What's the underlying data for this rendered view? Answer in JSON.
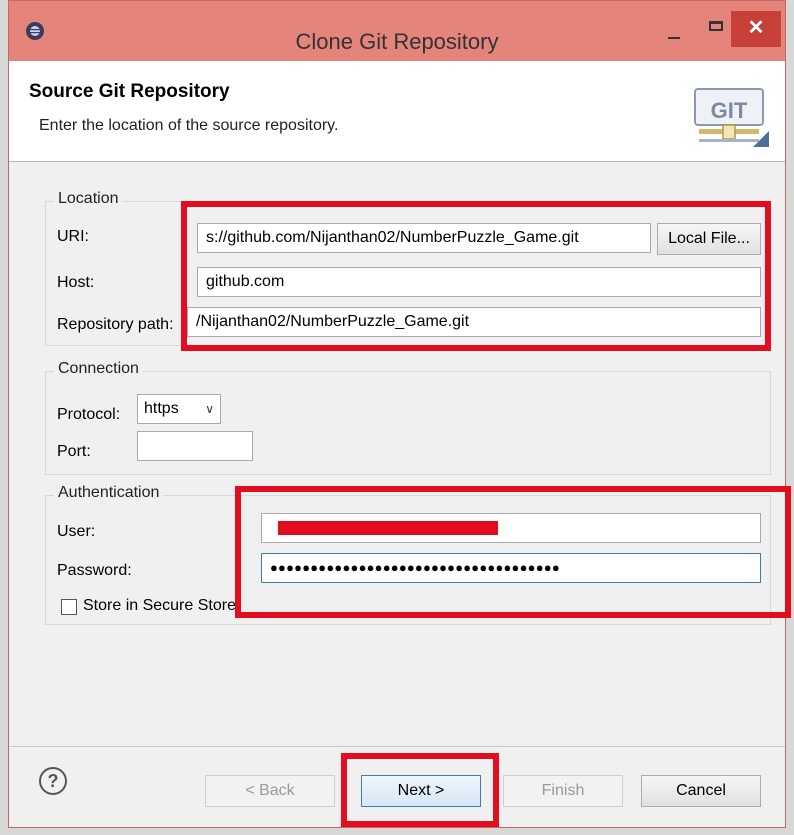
{
  "window": {
    "title": "Clone Git Repository",
    "close_glyph": "✕"
  },
  "header": {
    "title": "Source Git Repository",
    "description": "Enter the location of the source repository.",
    "logo_text": "GIT"
  },
  "location": {
    "group_label": "Location",
    "uri_label": "URI:",
    "uri_value": "s://github.com/Nijanthan02/NumberPuzzle_Game.git",
    "local_file_button": "Local File...",
    "host_label": "Host:",
    "host_value": "github.com",
    "repo_path_label": "Repository path:",
    "repo_path_value": "/Nijanthan02/NumberPuzzle_Game.git"
  },
  "connection": {
    "group_label": "Connection",
    "protocol_label": "Protocol:",
    "protocol_value": "https",
    "port_label": "Port:",
    "port_value": ""
  },
  "authentication": {
    "group_label": "Authentication",
    "user_label": "User:",
    "password_label": "Password:",
    "password_value": "●●●●●●●●●●●●●●●●●●●●●●●●●●●●●●●●●●●●",
    "store_label": "Store in Secure Store"
  },
  "buttons": {
    "help": "?",
    "back": "< Back",
    "next": "Next >",
    "finish": "Finish",
    "cancel": "Cancel"
  },
  "colors": {
    "titlebar": "#e4847a",
    "highlight": "#e20e1f",
    "focus": "#3c7fb1"
  }
}
